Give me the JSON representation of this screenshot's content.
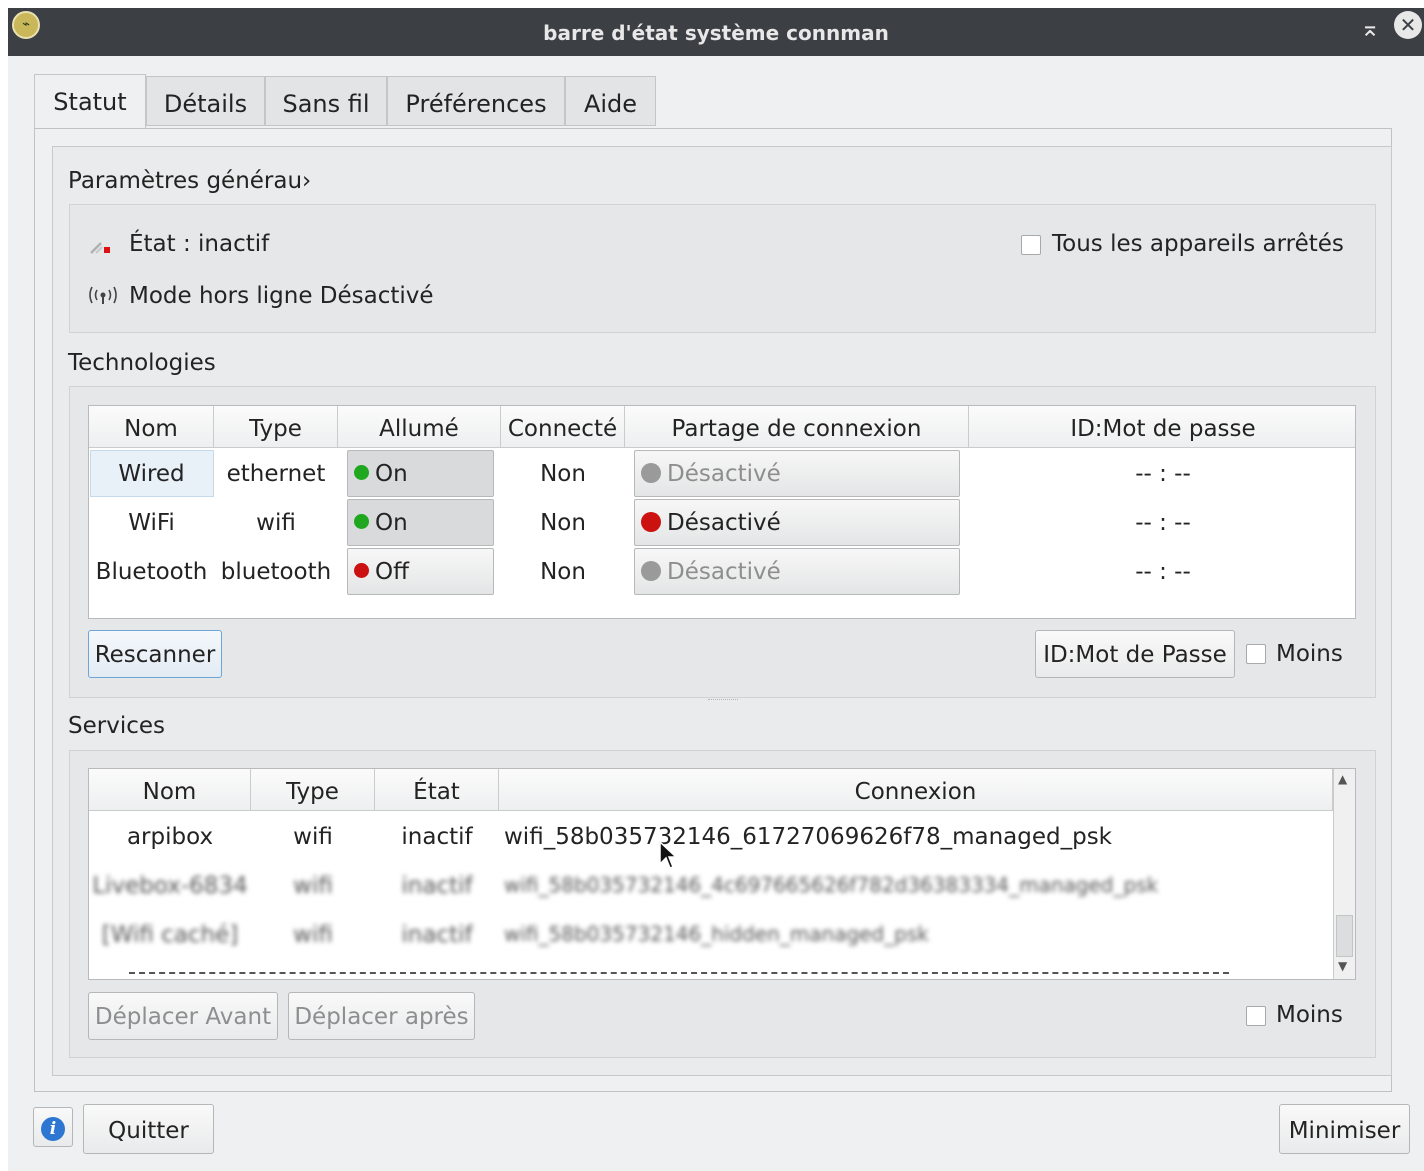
{
  "window": {
    "title": "barre d'état système connman"
  },
  "tabs": [
    {
      "label": "Statut",
      "active": true
    },
    {
      "label": "Détails",
      "active": false
    },
    {
      "label": "Sans fil",
      "active": false
    },
    {
      "label": "Préférences",
      "active": false
    },
    {
      "label": "Aide",
      "active": false
    }
  ],
  "general": {
    "title": "Paramètres générau›",
    "state_text": "État : inactif",
    "offline_text": "Mode hors ligne Désactivé",
    "all_devices_off_label": "Tous les appareils arrêtés",
    "all_devices_off_checked": false
  },
  "technologies": {
    "title": "Technologies",
    "headers": [
      "Nom",
      "Type",
      "Allumé",
      "Connecté",
      "Partage de connexion",
      "ID:Mot de passe"
    ],
    "rows": [
      {
        "name": "Wired",
        "type": "ethernet",
        "powered": "On",
        "powered_color": "#1fa81f",
        "connected": "Non",
        "sharing": "Désactivé",
        "sharing_color": "#9a9a9a",
        "sharing_enabled": false,
        "id": "-- : --"
      },
      {
        "name": "WiFi",
        "type": "wifi",
        "powered": "On",
        "powered_color": "#1fa81f",
        "connected": "Non",
        "sharing": "Désactivé",
        "sharing_color": "#cc1111",
        "sharing_enabled": true,
        "id": "-- : --"
      },
      {
        "name": "Bluetooth",
        "type": "bluetooth",
        "powered": "Off",
        "powered_color": "#cc1111",
        "connected": "Non",
        "sharing": "Désactivé",
        "sharing_color": "#9a9a9a",
        "sharing_enabled": false,
        "id": "-- : --"
      }
    ],
    "rescan_label": "Rescanner",
    "id_password_button": "ID:Mot de Passe",
    "less_label": "Moins"
  },
  "services": {
    "title": "Services",
    "headers": [
      "Nom",
      "Type",
      "État",
      "Connexion"
    ],
    "rows": [
      {
        "name": "arpibox",
        "type": "wifi",
        "state": "inactif",
        "connection": "wifi_58b035732146_61727069626f78_managed_psk"
      },
      {
        "name": "Livebox-6834",
        "type": "wifi",
        "state": "inactif",
        "connection": "wifi_58b035732146_4c697665626f782d36383334_managed_psk"
      },
      {
        "name": "[Wifi caché]",
        "type": "wifi",
        "state": "inactif",
        "connection": "wifi_58b035732146_hidden_managed_psk"
      }
    ],
    "move_before_label": "Déplacer Avant",
    "move_after_label": "Déplacer après",
    "less_label": "Moins"
  },
  "footer": {
    "quit_label": "Quitter",
    "minimize_label": "Minimiser"
  },
  "colors": {
    "titlebar": "#3c3f44",
    "window_bg": "#eff0f1",
    "focus_border": "#6da5d8"
  }
}
